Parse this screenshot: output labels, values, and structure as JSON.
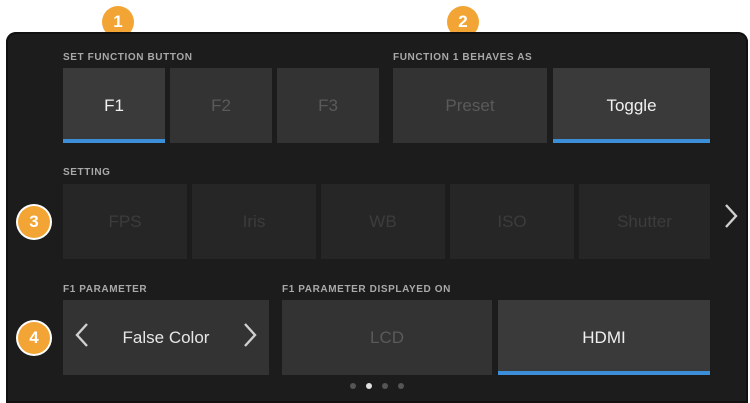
{
  "callouts": [
    "1",
    "2",
    "3",
    "4"
  ],
  "function_button": {
    "label": "SET FUNCTION BUTTON",
    "options": [
      "F1",
      "F2",
      "F3"
    ],
    "selected": "F1"
  },
  "behavior": {
    "label": "FUNCTION 1 BEHAVES AS",
    "options": [
      "Preset",
      "Toggle"
    ],
    "selected": "Toggle"
  },
  "setting": {
    "label": "SETTING",
    "options": [
      "FPS",
      "Iris",
      "WB",
      "ISO",
      "Shutter"
    ],
    "next_icon": "chevron-right-icon"
  },
  "parameter": {
    "label": "F1 PARAMETER",
    "value": "False Color",
    "prev_icon": "chevron-left-icon",
    "next_icon": "chevron-right-icon"
  },
  "display_on": {
    "label": "F1 PARAMETER DISPLAYED ON",
    "options": [
      "LCD",
      "HDMI"
    ],
    "selected": "HDMI"
  },
  "pagination": {
    "pages": 4,
    "current": 2
  },
  "colors": {
    "accent": "#3c8ed8",
    "callout": "#f2a535"
  }
}
